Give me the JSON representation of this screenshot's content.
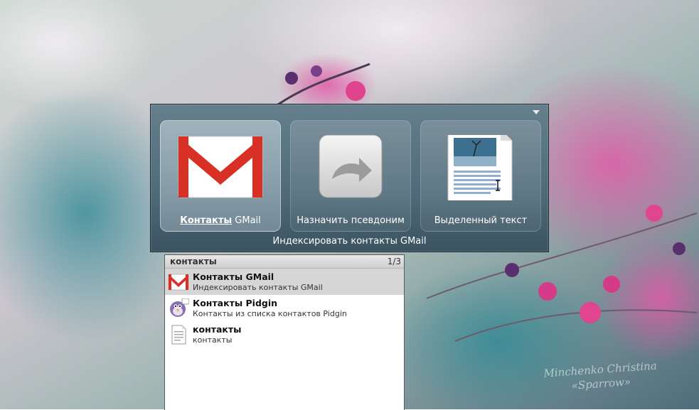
{
  "launcher": {
    "tiles": [
      {
        "label_bold": "Контакты",
        "label_rest": " GMail",
        "icon": "gmail-icon"
      },
      {
        "label": "Назначить псевдоним",
        "icon": "alias-arrow-icon"
      },
      {
        "label": "Выделенный текст",
        "icon": "text-document-icon"
      }
    ],
    "description": "Индексировать контакты GMail",
    "colors": {
      "panel": "#587482",
      "gmail_red": "#d93025"
    }
  },
  "results": {
    "header_title": "контакты",
    "counter": "1/3",
    "items": [
      {
        "title": "Контакты GMail",
        "subtitle": "Индексировать контакты GMail",
        "icon": "gmail-icon"
      },
      {
        "title": "Контакты Pidgin",
        "subtitle": "Контакты из списка контактов Pidgin",
        "icon": "pidgin-icon"
      },
      {
        "title": "контакты",
        "subtitle": "контакты",
        "icon": "document-icon"
      }
    ]
  },
  "watermark": {
    "line1": "Minchenko Christina",
    "line2": "«Sparrow»"
  }
}
